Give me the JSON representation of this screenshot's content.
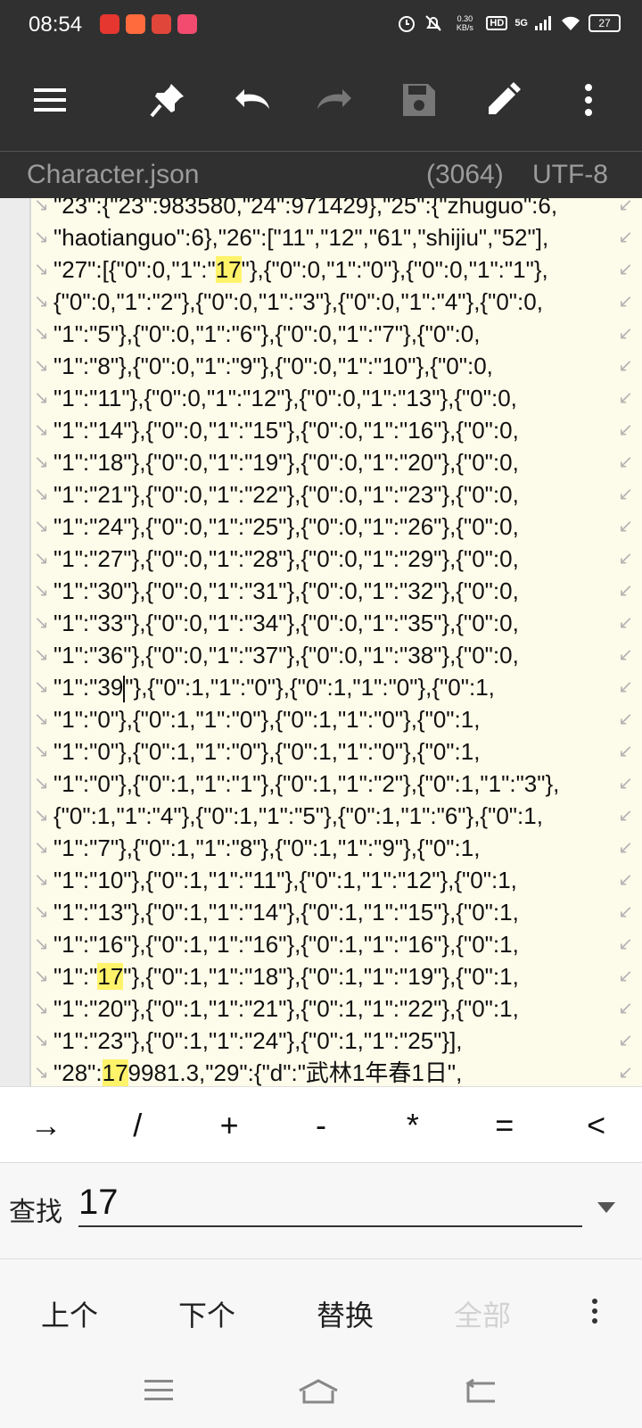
{
  "status_bar": {
    "time": "08:54",
    "net_speed": "0.30 KB/s",
    "hd": "HD",
    "signal": "5G",
    "battery": "27",
    "app_icon_colors": [
      "#e5362f",
      "#ff6b3d",
      "#e0463a",
      "#f24b6f"
    ]
  },
  "toolbar": {
    "icons": [
      "menu-icon",
      "pin-icon",
      "undo-icon",
      "redo-icon",
      "save-icon",
      "edit-icon",
      "more-vertical-icon"
    ]
  },
  "file_bar": {
    "filename": "Character.json",
    "count": "(3064)",
    "encoding": "UTF-8"
  },
  "editor": {
    "highlight_color": "#fff36a",
    "lines": [
      {
        "segments": [
          "\"23\":{\"23\":983580,\"24\":971429},\"25\":{\"zhuguo\":6,"
        ],
        "wrap": true
      },
      {
        "segments": [
          "\"haotianguo\":6},\"26\":[\"11\",\"12\",\"61\",\"shijiu\",\"52\"],"
        ],
        "wrap": true
      },
      {
        "segments": [
          "\"27\":[{\"0\":0,\"1\":\"",
          {
            "hl": "17"
          },
          "\"},{\"0\":0,\"1\":\"0\"},{\"0\":0,\"1\":\"1\"},"
        ],
        "wrap": true
      },
      {
        "segments": [
          "{\"0\":0,\"1\":\"2\"},{\"0\":0,\"1\":\"3\"},{\"0\":0,\"1\":\"4\"},{\"0\":0,"
        ],
        "wrap": true
      },
      {
        "segments": [
          "\"1\":\"5\"},{\"0\":0,\"1\":\"6\"},{\"0\":0,\"1\":\"7\"},{\"0\":0,"
        ],
        "wrap": true
      },
      {
        "segments": [
          "\"1\":\"8\"},{\"0\":0,\"1\":\"9\"},{\"0\":0,\"1\":\"10\"},{\"0\":0,"
        ],
        "wrap": true
      },
      {
        "segments": [
          "\"1\":\"11\"},{\"0\":0,\"1\":\"12\"},{\"0\":0,\"1\":\"13\"},{\"0\":0,"
        ],
        "wrap": true
      },
      {
        "segments": [
          "\"1\":\"14\"},{\"0\":0,\"1\":\"15\"},{\"0\":0,\"1\":\"16\"},{\"0\":0,"
        ],
        "wrap": true
      },
      {
        "segments": [
          "\"1\":\"18\"},{\"0\":0,\"1\":\"19\"},{\"0\":0,\"1\":\"20\"},{\"0\":0,"
        ],
        "wrap": true
      },
      {
        "segments": [
          "\"1\":\"21\"},{\"0\":0,\"1\":\"22\"},{\"0\":0,\"1\":\"23\"},{\"0\":0,"
        ],
        "wrap": true
      },
      {
        "segments": [
          "\"1\":\"24\"},{\"0\":0,\"1\":\"25\"},{\"0\":0,\"1\":\"26\"},{\"0\":0,"
        ],
        "wrap": true
      },
      {
        "segments": [
          "\"1\":\"27\"},{\"0\":0,\"1\":\"28\"},{\"0\":0,\"1\":\"29\"},{\"0\":0,"
        ],
        "wrap": true
      },
      {
        "segments": [
          "\"1\":\"30\"},{\"0\":0,\"1\":\"31\"},{\"0\":0,\"1\":\"32\"},{\"0\":0,"
        ],
        "wrap": true
      },
      {
        "segments": [
          "\"1\":\"33\"},{\"0\":0,\"1\":\"34\"},{\"0\":0,\"1\":\"35\"},{\"0\":0,"
        ],
        "wrap": true
      },
      {
        "segments": [
          "\"1\":\"36\"},{\"0\":0,\"1\":\"37\"},{\"0\":0,\"1\":\"38\"},{\"0\":0,"
        ],
        "wrap": true
      },
      {
        "segments": [
          "\"1\":\"39",
          {
            "cursor": true
          },
          "\"},{\"0\":1,\"1\":\"0\"},{\"0\":1,\"1\":\"0\"},{\"0\":1,"
        ],
        "wrap": true
      },
      {
        "segments": [
          "\"1\":\"0\"},{\"0\":1,\"1\":\"0\"},{\"0\":1,\"1\":\"0\"},{\"0\":1,"
        ],
        "wrap": true
      },
      {
        "segments": [
          "\"1\":\"0\"},{\"0\":1,\"1\":\"0\"},{\"0\":1,\"1\":\"0\"},{\"0\":1,"
        ],
        "wrap": true
      },
      {
        "segments": [
          "\"1\":\"0\"},{\"0\":1,\"1\":\"1\"},{\"0\":1,\"1\":\"2\"},{\"0\":1,\"1\":\"3\"},"
        ],
        "wrap": true
      },
      {
        "segments": [
          "{\"0\":1,\"1\":\"4\"},{\"0\":1,\"1\":\"5\"},{\"0\":1,\"1\":\"6\"},{\"0\":1,"
        ],
        "wrap": true
      },
      {
        "segments": [
          "\"1\":\"7\"},{\"0\":1,\"1\":\"8\"},{\"0\":1,\"1\":\"9\"},{\"0\":1,"
        ],
        "wrap": true
      },
      {
        "segments": [
          "\"1\":\"10\"},{\"0\":1,\"1\":\"11\"},{\"0\":1,\"1\":\"12\"},{\"0\":1,"
        ],
        "wrap": true
      },
      {
        "segments": [
          "\"1\":\"13\"},{\"0\":1,\"1\":\"14\"},{\"0\":1,\"1\":\"15\"},{\"0\":1,"
        ],
        "wrap": true
      },
      {
        "segments": [
          "\"1\":\"16\"},{\"0\":1,\"1\":\"16\"},{\"0\":1,\"1\":\"16\"},{\"0\":1,"
        ],
        "wrap": true
      },
      {
        "segments": [
          "\"1\":\"",
          {
            "hl": "17"
          },
          "\"},{\"0\":1,\"1\":\"18\"},{\"0\":1,\"1\":\"19\"},{\"0\":1,"
        ],
        "wrap": true
      },
      {
        "segments": [
          "\"1\":\"20\"},{\"0\":1,\"1\":\"21\"},{\"0\":1,\"1\":\"22\"},{\"0\":1,"
        ],
        "wrap": true
      },
      {
        "segments": [
          "\"1\":\"23\"},{\"0\":1,\"1\":\"24\"},{\"0\":1,\"1\":\"25\"}],"
        ],
        "wrap": true
      },
      {
        "segments": [
          "\"28\":",
          {
            "hl": "17"
          },
          "9981.3,\"29\":{\"d\":\"武林1年春1日\","
        ],
        "wrap": true
      }
    ]
  },
  "symbol_bar": [
    "→",
    "/",
    "+",
    "-",
    "*",
    "=",
    "<"
  ],
  "find": {
    "label": "查找",
    "value": "17"
  },
  "actions": {
    "prev": "上个",
    "next": "下个",
    "replace": "替换",
    "all": "全部"
  }
}
